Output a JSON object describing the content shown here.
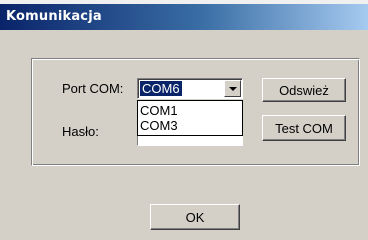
{
  "window": {
    "title": "Komunikacja"
  },
  "form": {
    "port_label": "Port COM:",
    "password_label": "Hasło:",
    "port_selected": "COM6",
    "port_options_visible": [
      "COM1",
      "COM3"
    ],
    "password_value": ""
  },
  "buttons": {
    "refresh_label": "Odswież",
    "test_label": "Test COM",
    "ok_label": "OK"
  },
  "icons": {
    "dropdown": "chevron-down-icon"
  },
  "colors": {
    "title_gradient_start": "#0a246a",
    "title_gradient_end": "#a6caf0",
    "dialog_background": "#d4d0c8",
    "selection_background": "#0a246a"
  }
}
